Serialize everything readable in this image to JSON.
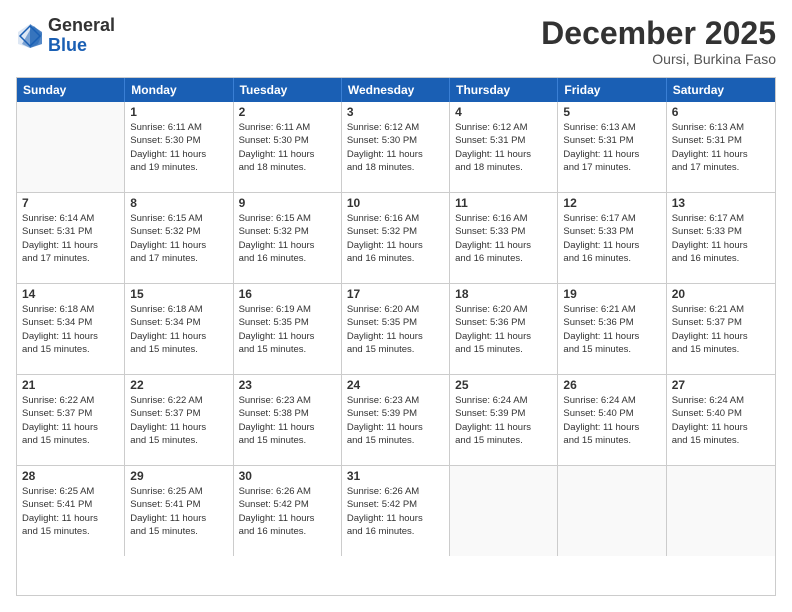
{
  "header": {
    "logo_general": "General",
    "logo_blue": "Blue",
    "month_title": "December 2025",
    "location": "Oursi, Burkina Faso"
  },
  "calendar": {
    "days_of_week": [
      "Sunday",
      "Monday",
      "Tuesday",
      "Wednesday",
      "Thursday",
      "Friday",
      "Saturday"
    ],
    "weeks": [
      [
        {
          "day": "",
          "info": ""
        },
        {
          "day": "1",
          "info": "Sunrise: 6:11 AM\nSunset: 5:30 PM\nDaylight: 11 hours\nand 19 minutes."
        },
        {
          "day": "2",
          "info": "Sunrise: 6:11 AM\nSunset: 5:30 PM\nDaylight: 11 hours\nand 18 minutes."
        },
        {
          "day": "3",
          "info": "Sunrise: 6:12 AM\nSunset: 5:30 PM\nDaylight: 11 hours\nand 18 minutes."
        },
        {
          "day": "4",
          "info": "Sunrise: 6:12 AM\nSunset: 5:31 PM\nDaylight: 11 hours\nand 18 minutes."
        },
        {
          "day": "5",
          "info": "Sunrise: 6:13 AM\nSunset: 5:31 PM\nDaylight: 11 hours\nand 17 minutes."
        },
        {
          "day": "6",
          "info": "Sunrise: 6:13 AM\nSunset: 5:31 PM\nDaylight: 11 hours\nand 17 minutes."
        }
      ],
      [
        {
          "day": "7",
          "info": "Sunrise: 6:14 AM\nSunset: 5:31 PM\nDaylight: 11 hours\nand 17 minutes."
        },
        {
          "day": "8",
          "info": "Sunrise: 6:15 AM\nSunset: 5:32 PM\nDaylight: 11 hours\nand 17 minutes."
        },
        {
          "day": "9",
          "info": "Sunrise: 6:15 AM\nSunset: 5:32 PM\nDaylight: 11 hours\nand 16 minutes."
        },
        {
          "day": "10",
          "info": "Sunrise: 6:16 AM\nSunset: 5:32 PM\nDaylight: 11 hours\nand 16 minutes."
        },
        {
          "day": "11",
          "info": "Sunrise: 6:16 AM\nSunset: 5:33 PM\nDaylight: 11 hours\nand 16 minutes."
        },
        {
          "day": "12",
          "info": "Sunrise: 6:17 AM\nSunset: 5:33 PM\nDaylight: 11 hours\nand 16 minutes."
        },
        {
          "day": "13",
          "info": "Sunrise: 6:17 AM\nSunset: 5:33 PM\nDaylight: 11 hours\nand 16 minutes."
        }
      ],
      [
        {
          "day": "14",
          "info": "Sunrise: 6:18 AM\nSunset: 5:34 PM\nDaylight: 11 hours\nand 15 minutes."
        },
        {
          "day": "15",
          "info": "Sunrise: 6:18 AM\nSunset: 5:34 PM\nDaylight: 11 hours\nand 15 minutes."
        },
        {
          "day": "16",
          "info": "Sunrise: 6:19 AM\nSunset: 5:35 PM\nDaylight: 11 hours\nand 15 minutes."
        },
        {
          "day": "17",
          "info": "Sunrise: 6:20 AM\nSunset: 5:35 PM\nDaylight: 11 hours\nand 15 minutes."
        },
        {
          "day": "18",
          "info": "Sunrise: 6:20 AM\nSunset: 5:36 PM\nDaylight: 11 hours\nand 15 minutes."
        },
        {
          "day": "19",
          "info": "Sunrise: 6:21 AM\nSunset: 5:36 PM\nDaylight: 11 hours\nand 15 minutes."
        },
        {
          "day": "20",
          "info": "Sunrise: 6:21 AM\nSunset: 5:37 PM\nDaylight: 11 hours\nand 15 minutes."
        }
      ],
      [
        {
          "day": "21",
          "info": "Sunrise: 6:22 AM\nSunset: 5:37 PM\nDaylight: 11 hours\nand 15 minutes."
        },
        {
          "day": "22",
          "info": "Sunrise: 6:22 AM\nSunset: 5:37 PM\nDaylight: 11 hours\nand 15 minutes."
        },
        {
          "day": "23",
          "info": "Sunrise: 6:23 AM\nSunset: 5:38 PM\nDaylight: 11 hours\nand 15 minutes."
        },
        {
          "day": "24",
          "info": "Sunrise: 6:23 AM\nSunset: 5:39 PM\nDaylight: 11 hours\nand 15 minutes."
        },
        {
          "day": "25",
          "info": "Sunrise: 6:24 AM\nSunset: 5:39 PM\nDaylight: 11 hours\nand 15 minutes."
        },
        {
          "day": "26",
          "info": "Sunrise: 6:24 AM\nSunset: 5:40 PM\nDaylight: 11 hours\nand 15 minutes."
        },
        {
          "day": "27",
          "info": "Sunrise: 6:24 AM\nSunset: 5:40 PM\nDaylight: 11 hours\nand 15 minutes."
        }
      ],
      [
        {
          "day": "28",
          "info": "Sunrise: 6:25 AM\nSunset: 5:41 PM\nDaylight: 11 hours\nand 15 minutes."
        },
        {
          "day": "29",
          "info": "Sunrise: 6:25 AM\nSunset: 5:41 PM\nDaylight: 11 hours\nand 15 minutes."
        },
        {
          "day": "30",
          "info": "Sunrise: 6:26 AM\nSunset: 5:42 PM\nDaylight: 11 hours\nand 16 minutes."
        },
        {
          "day": "31",
          "info": "Sunrise: 6:26 AM\nSunset: 5:42 PM\nDaylight: 11 hours\nand 16 minutes."
        },
        {
          "day": "",
          "info": ""
        },
        {
          "day": "",
          "info": ""
        },
        {
          "day": "",
          "info": ""
        }
      ]
    ]
  }
}
